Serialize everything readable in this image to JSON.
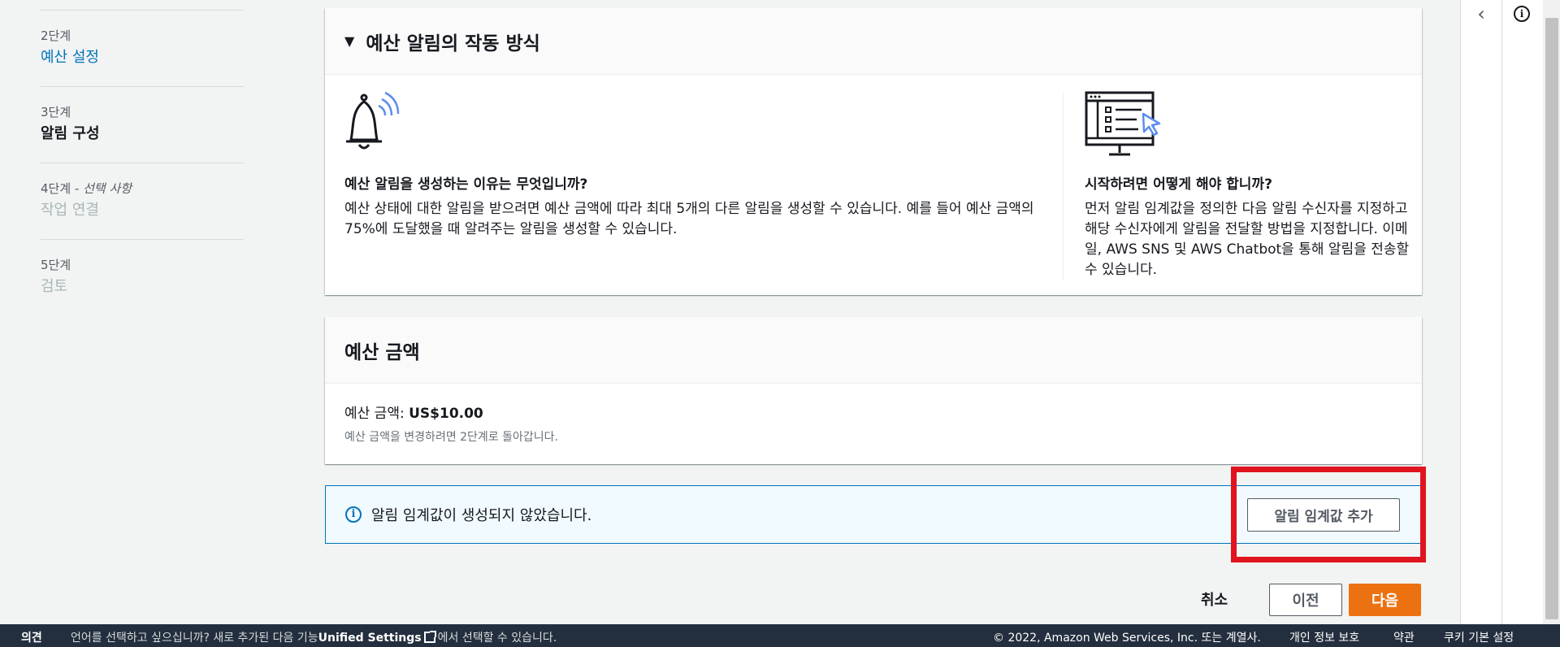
{
  "steps": [
    {
      "num": "2단계",
      "title": "예산 설정",
      "state": "link"
    },
    {
      "num": "3단계",
      "title": "알림 구성",
      "state": "current"
    },
    {
      "num": "4단계 - ",
      "optional": "선택 사항",
      "title": "작업 연결",
      "state": "disabled"
    },
    {
      "num": "5단계",
      "title": "검토",
      "state": "disabled"
    }
  ],
  "how_it_works": {
    "title": "예산 알림의 작동 방식",
    "why": {
      "title": "예산 알림을 생성하는 이유는 무엇입니까?",
      "body": "예산 상태에 대한 알림을 받으려면 예산 금액에 따라 최대 5개의 다른 알림을 생성할 수 있습니다. 예를 들어 예산 금액의 75%에 도달했을 때 알려주는 알림을 생성할 수 있습니다.",
      "icon": "bell-icon"
    },
    "how": {
      "title": "시작하려면 어떻게 해야 합니까?",
      "body": "먼저 알림 임계값을 정의한 다음 알림 수신자를 지정하고 해당 수신자에게 알림을 전달할 방법을 지정합니다. 이메일, AWS SNS 및 AWS Chatbot을 통해 알림을 전송할 수 있습니다.",
      "icon": "monitor-list-icon"
    }
  },
  "amount": {
    "title": "예산 금액",
    "label": "예산 금액: ",
    "value": "US$10.00",
    "hint": "예산 금액을 변경하려면 2단계로 돌아갑니다."
  },
  "alert": {
    "text": "알림 임계값이 생성되지 않았습니다.",
    "button": "알림 임계값 추가"
  },
  "actions": {
    "cancel": "취소",
    "previous": "이전",
    "next": "다음"
  },
  "footer": {
    "feedback": "의견",
    "lang_pre": "언어를 선택하고 싶으십니까? 새로 추가된 다음 기능",
    "lang_link": "Unified Settings",
    "lang_post": "에서 선택할 수 있습니다.",
    "copyright": "© 2022, Amazon Web Services, Inc. 또는 계열사.",
    "privacy": "개인 정보 보호",
    "terms": "약관",
    "cookies": "쿠키 기본 설정"
  },
  "colors": {
    "primary": "#ec7211",
    "link": "#0073bb",
    "highlight": "#e0141e",
    "footer": "#232f3e"
  }
}
